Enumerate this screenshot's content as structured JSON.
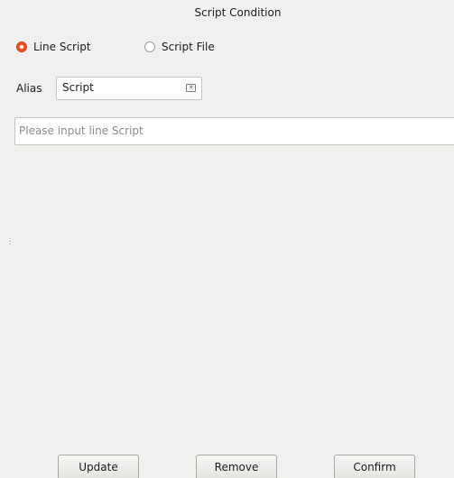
{
  "window": {
    "title": "Script Condition"
  },
  "mode": {
    "options": [
      {
        "label": "Line Script",
        "checked": true
      },
      {
        "label": "Script File",
        "checked": false
      }
    ]
  },
  "alias": {
    "label": "Alias",
    "value": "Script"
  },
  "script": {
    "placeholder": "Please input line Script",
    "value": ""
  },
  "buttons": {
    "update": "Update",
    "remove": "Remove",
    "confirm": "Confirm"
  },
  "icons": {
    "clear": "clear-input-icon",
    "radio": "radio-icon"
  },
  "colors": {
    "accent": "#e95420",
    "background": "#f1f0ee"
  }
}
